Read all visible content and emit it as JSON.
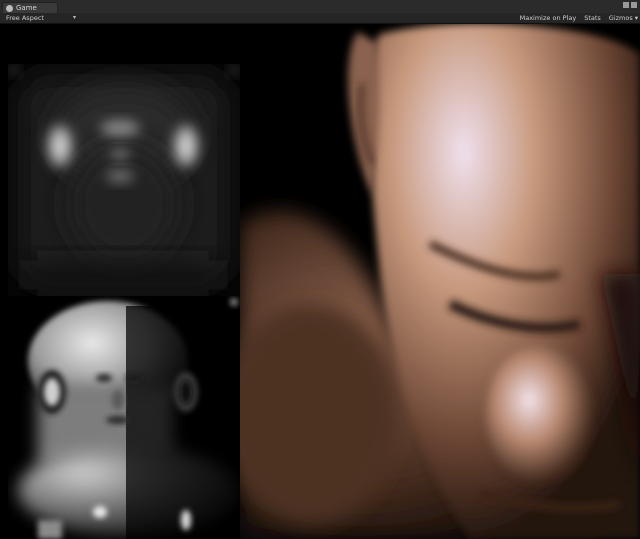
{
  "window": {
    "tab_label": "Game"
  },
  "toolbar": {
    "aspect_label": "Free Aspect",
    "maximize_label": "Maximize on Play",
    "stats_label": "Stats",
    "gizmos_label": "Gizmos"
  },
  "icons": {
    "tab": "game-controller-icon",
    "aspect_dropdown": "dropdown-arrow-icon",
    "gizmos_dropdown": "dropdown-arrow-icon"
  },
  "colors": {
    "chrome_dark": "#252525",
    "chrome_tab": "#3a3a3a",
    "text": "#d0d0d0",
    "skin": "#c89a7e"
  }
}
